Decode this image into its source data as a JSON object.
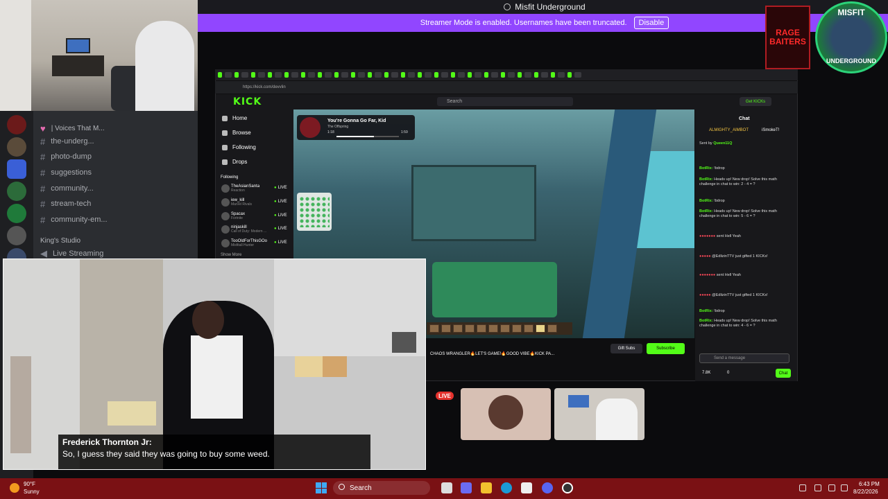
{
  "window": {
    "title": "Misfit Underground"
  },
  "banner": {
    "text": "Streamer Mode is enabled. Usernames have been truncated.",
    "button": "Disable"
  },
  "discord": {
    "channels": [
      {
        "label": "| Voices That M...",
        "kind": "voice"
      },
      {
        "label": "the-underg...",
        "kind": "text"
      },
      {
        "label": "photo-dump",
        "kind": "text"
      },
      {
        "label": "suggestions",
        "kind": "text"
      },
      {
        "label": "community...",
        "kind": "text"
      },
      {
        "label": "stream-tech",
        "kind": "text"
      },
      {
        "label": "community-em...",
        "kind": "text"
      }
    ],
    "category": "King's Studio",
    "live_streaming": "Live Streaming"
  },
  "browser": {
    "url": "https://kick.com/devvlin"
  },
  "kick": {
    "logo": "KICK",
    "search_placeholder": "Search",
    "get_kicks": "Get KICKs",
    "nav": [
      "Home",
      "Browse",
      "Following",
      "Drops"
    ],
    "following_header": "Following",
    "following": [
      {
        "name": "TheAsianSanta",
        "sub": "Reaction",
        "status": "LIVE"
      },
      {
        "name": "iew_kill",
        "sub": "Marvel Rivals",
        "status": "LIVE"
      },
      {
        "name": "Spacax",
        "sub": "Fortnite",
        "status": "LIVE"
      },
      {
        "name": "ninjaskill",
        "sub": "Call of Duty: Modern ...",
        "status": "LIVE"
      },
      {
        "name": "TooOldForThisGOo",
        "sub": "Misfitall Hunter",
        "status": "LIVE"
      }
    ],
    "show_more": "Show More",
    "now_playing": {
      "title": "You're Gonna Go Far, Kid",
      "artist": "The Offspring",
      "elapsed": "1:18",
      "total": "1:59",
      "progress": 0.6
    },
    "stream_title": "CHAOS WRANGLER🔥LET'S GAME!🔥GOOD VIBE🔥KICK PA...",
    "gift_subs": "Gift Subs",
    "subscribe": "Subscribe"
  },
  "chat": {
    "title": "Chat",
    "pinned_left": "ALMIGHTY_AIMBOT",
    "pinned_right": "iSmokeT!",
    "sent_by": "Sent by",
    "sent_by_user": "Queen11Q",
    "lines": [
      {
        "user": "BotRix:",
        "text": "!bdrop"
      },
      {
        "user": "BotRix:",
        "text": "Heads up! New drop! Solve this math challenge in chat to win: 2 - 4 = ?"
      },
      {
        "user": "BotRix:",
        "text": "!bdrop"
      },
      {
        "user": "BotRix:",
        "text": "Heads up! New drop! Solve this math challenge in chat to win: 5 - 6 = ?"
      },
      {
        "user": "",
        "text": "sent Hell Yeah"
      },
      {
        "user": "",
        "text": "@EdlizinTTV just gifted 1 KICKs!"
      },
      {
        "user": "",
        "text": "sent Hell Yeah"
      },
      {
        "user": "",
        "text": "@EdlizinTTV just gifted 1 KICKs!"
      },
      {
        "user": "BotRix:",
        "text": "!bdrop"
      },
      {
        "user": "BotRix:",
        "text": "Heads up! New drop! Solve this math challenge in chat to win: 4 - 6 = ?"
      }
    ],
    "input_placeholder": "Send a message",
    "viewers": "7.8K",
    "points": "0",
    "send": "Chat"
  },
  "video": {
    "speaker": "Frederick Thornton Jr:",
    "caption": "So, I guess they said they was going to buy some weed."
  },
  "live_pill": "LIVE",
  "logos": {
    "rage": "RAGE BAITERS",
    "misfit_top": "MISFIT",
    "misfit_bottom": "UNDERGROUND"
  },
  "taskbar": {
    "weather_temp": "90°F",
    "weather_desc": "Sunny",
    "search": "Search",
    "time": "6:43 PM",
    "date": "8/22/2026"
  },
  "colors": {
    "kick_green": "#53fc18",
    "banner_purple": "#9146ff",
    "taskbar_red": "#7a1114",
    "live_red": "#e5322d"
  }
}
